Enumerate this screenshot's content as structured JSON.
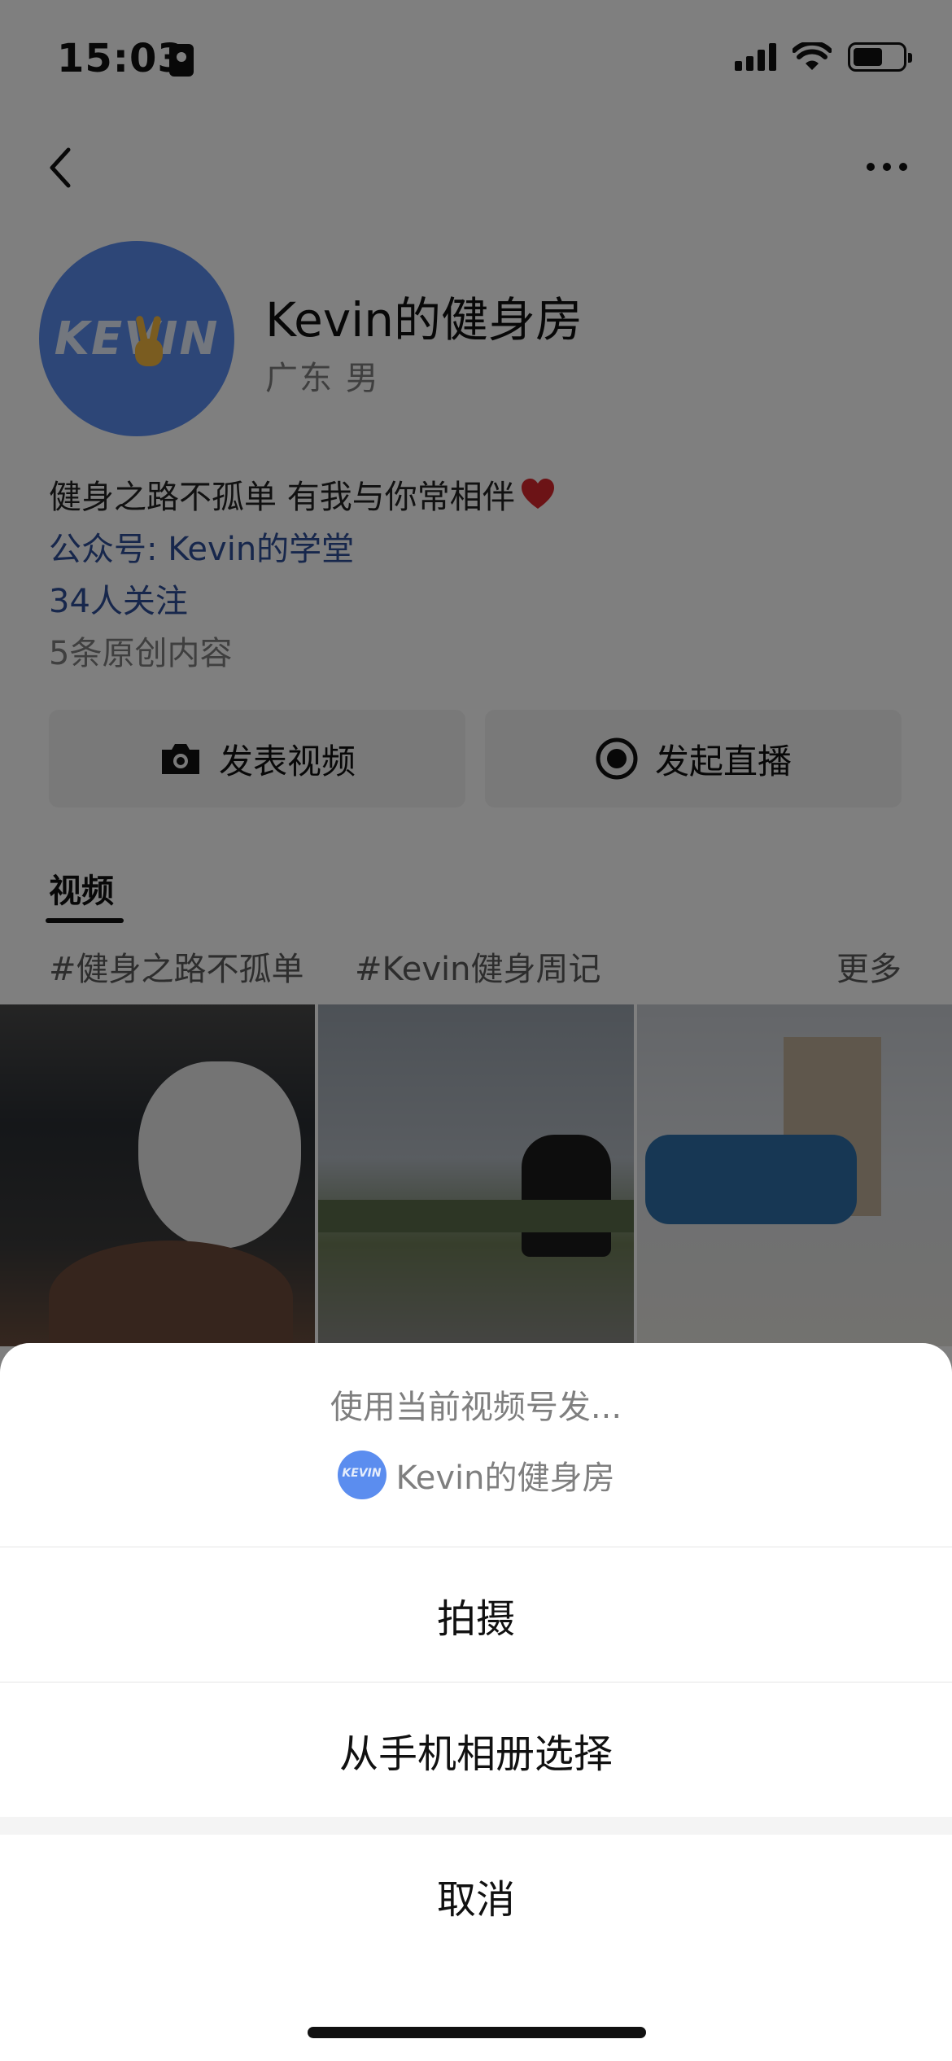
{
  "status_bar": {
    "time": "15:03"
  },
  "profile": {
    "name": "Kevin的健身房",
    "meta": "广东 男",
    "avatar_text": "KEVIN",
    "bio": "健身之路不孤单 有我与你常相伴",
    "official_account": "公众号: Kevin的学堂",
    "followers": "34人关注",
    "original_count": "5条原创内容"
  },
  "actions": {
    "publish_video": "发表视频",
    "start_live": "发起直播"
  },
  "tabs": {
    "videos": "视频"
  },
  "topics": {
    "items": [
      "#健身之路不孤单",
      "#Kevin健身周记"
    ],
    "more": "更多"
  },
  "sheet": {
    "hint": "使用当前视频号发...",
    "account_name": "Kevin的健身房",
    "avatar_text": "KEVIN",
    "shoot": "拍摄",
    "choose_album": "从手机相册选择",
    "cancel": "取消"
  },
  "colors": {
    "link": "#2f4e99",
    "avatar_bg": "#5b8def",
    "overlay": "rgba(0,0,0,0.5)"
  },
  "icons": [
    "back-icon",
    "more-icon",
    "heart-icon",
    "camera-icon",
    "live-icon"
  ]
}
